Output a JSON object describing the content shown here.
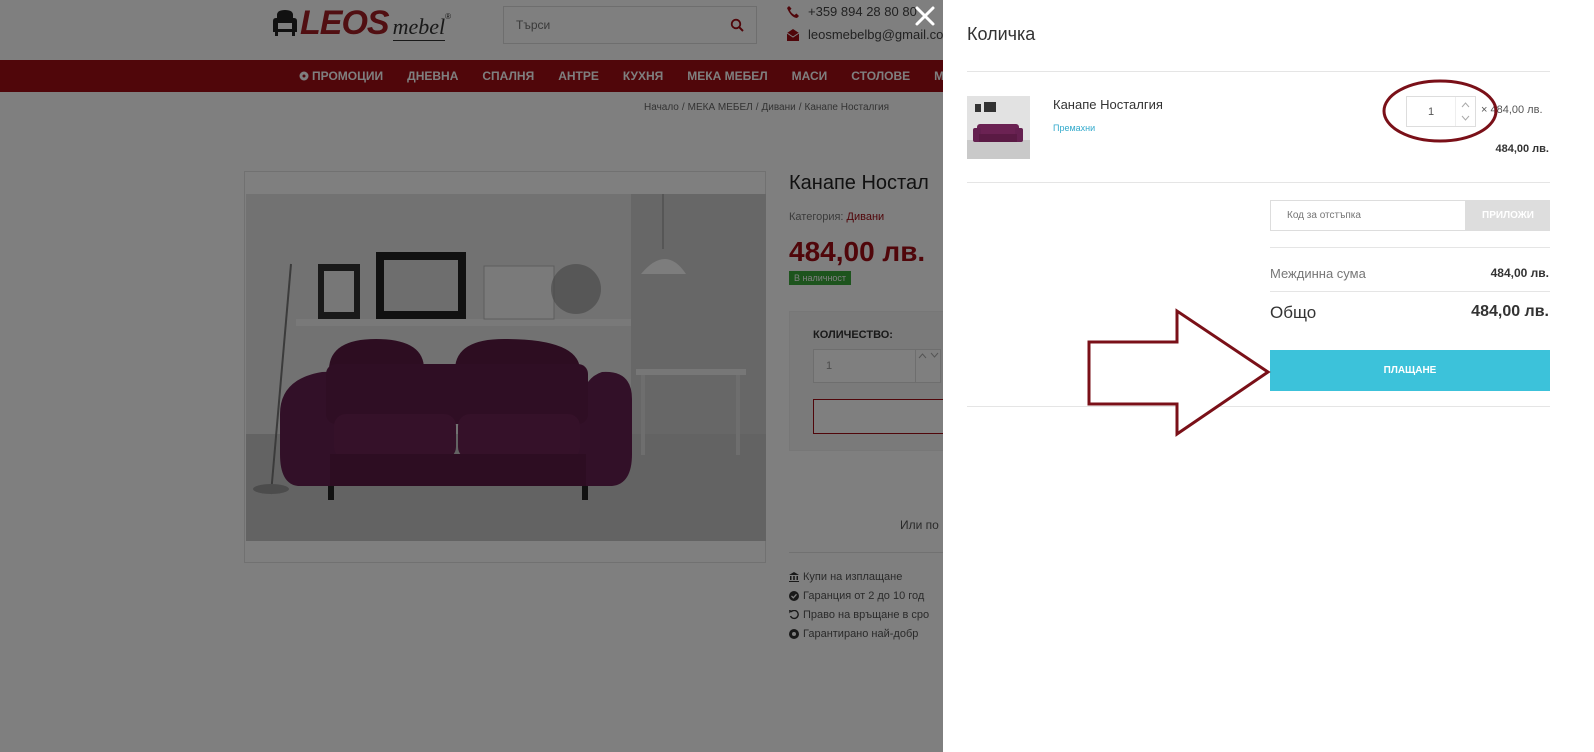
{
  "header": {
    "logo_main": "LEOS",
    "logo_sub": "mebel",
    "logo_reg": "®",
    "search_placeholder": "Търси",
    "phone": "+359 894 28 80 80",
    "email": "leosmebelbg@gmail.co"
  },
  "nav": {
    "items": [
      "ПРОМОЦИИ",
      "ДНЕВНА",
      "СПАЛНЯ",
      "АНТРЕ",
      "КУХНЯ",
      "МЕКА МЕБЕЛ",
      "МАСИ",
      "СТОЛОВЕ",
      "МА"
    ]
  },
  "breadcrumb": [
    "Начало",
    "/",
    "МЕКА МЕБЕЛ",
    "/",
    "Дивани",
    "/",
    "Канапе Носталгия"
  ],
  "product": {
    "title": "Канапе Ностал",
    "category_label": "Категория:",
    "category_value": "Дивани",
    "price": "484,00 лв.",
    "stock": "В наличност",
    "qty_label": "КОЛИЧЕСТВО:",
    "qty_value": "1",
    "or_pay": "Или по",
    "features": [
      "Купи на изплащане",
      "Гаранция от 2 до 10 год",
      "Право на връщане в сро",
      "Гарантирано най-добр"
    ]
  },
  "cart": {
    "title": "Количка",
    "item": {
      "name": "Канапе Носталгия",
      "remove_label": "Премахни",
      "quantity": "1",
      "unit_price": "× 484,00 лв.",
      "line_total": "484,00 лв."
    },
    "coupon_placeholder": "Код за отстъпка",
    "apply_label": "ПРИЛОЖИ",
    "subtotal_label": "Междинна сума",
    "subtotal_value": "484,00 лв.",
    "total_label": "Общо",
    "total_value": "484,00 лв.",
    "checkout_label": "ПЛАЩАНЕ"
  },
  "colors": {
    "brand_red": "#a00c14",
    "checkout_blue": "#3cc2da",
    "annotation": "#7a1018"
  }
}
